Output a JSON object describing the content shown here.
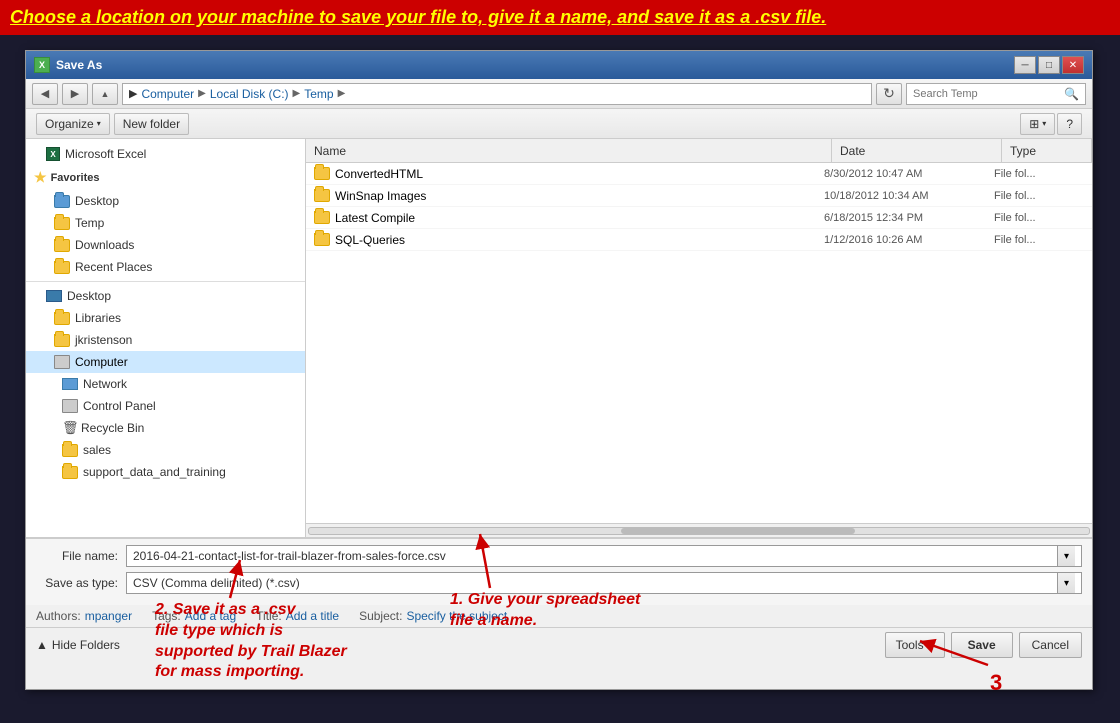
{
  "topBar": {
    "text": "Choose a location on your machine to save your file to, give it a name, and save it as a .csv file."
  },
  "dialog": {
    "title": "Save As",
    "titleIcon": "X",
    "breadcrumbs": [
      {
        "label": "Computer"
      },
      {
        "label": "Local Disk (C:)"
      },
      {
        "label": "Temp"
      }
    ],
    "searchPlaceholder": "Search Temp",
    "toolbar": {
      "organizeLabel": "Organize",
      "newFolderLabel": "New folder"
    },
    "sidebar": {
      "sections": [
        {
          "type": "excel",
          "label": "Microsoft Excel",
          "indent": 0
        },
        {
          "type": "header",
          "label": "Favorites",
          "indent": 0
        },
        {
          "type": "folder-blue",
          "label": "Desktop",
          "indent": 1
        },
        {
          "type": "folder",
          "label": "Temp",
          "indent": 1
        },
        {
          "type": "folder",
          "label": "Downloads",
          "indent": 1
        },
        {
          "type": "folder",
          "label": "Recent Places",
          "indent": 1
        },
        {
          "type": "divider"
        },
        {
          "type": "computer",
          "label": "Desktop",
          "indent": 0
        },
        {
          "type": "folder",
          "label": "Libraries",
          "indent": 1
        },
        {
          "type": "folder",
          "label": "jkristenson",
          "indent": 1
        },
        {
          "type": "computer-active",
          "label": "Computer",
          "indent": 0,
          "active": true
        },
        {
          "type": "network",
          "label": "Network",
          "indent": 1
        },
        {
          "type": "computer",
          "label": "Control Panel",
          "indent": 1
        },
        {
          "type": "recycle",
          "label": "Recycle Bin",
          "indent": 1
        },
        {
          "type": "folder",
          "label": "sales",
          "indent": 1
        },
        {
          "type": "folder",
          "label": "support_data_and_training",
          "indent": 1
        }
      ]
    },
    "fileList": {
      "columns": [
        {
          "label": "Name",
          "key": "name"
        },
        {
          "label": "Date",
          "key": "date"
        },
        {
          "label": "Type",
          "key": "type"
        }
      ],
      "files": [
        {
          "name": "ConvertedHTML",
          "date": "8/30/2012 10:47 AM",
          "type": "File fol..."
        },
        {
          "name": "WinSnap Images",
          "date": "10/18/2012 10:34 AM",
          "type": "File fol..."
        },
        {
          "name": "Latest Compile",
          "date": "6/18/2015 12:34 PM",
          "type": "File fol..."
        },
        {
          "name": "SQL-Queries",
          "date": "1/12/2016 10:26 AM",
          "type": "File fol..."
        }
      ]
    },
    "form": {
      "fileNameLabel": "File name:",
      "fileNameValue": "2016-04-21-contact-list-for-trail-blazer-from-sales-force.csv",
      "saveAsTypeLabel": "Save as type:",
      "saveAsTypeValue": "CSV (Comma delimited) (*.csv)",
      "authorsLabel": "Authors:",
      "authorsValue": "mpanger",
      "tagsLabel": "Tags:",
      "tagsValue": "Add a tag",
      "titleLabel": "Title:",
      "titleValue": "Add a title",
      "subjectLabel": "Subject:",
      "subjectValue": "Specify the subject"
    },
    "buttons": {
      "hideFolders": "Hide Folders",
      "tools": "Tools",
      "save": "Save",
      "cancel": "Cancel"
    }
  },
  "annotations": {
    "step1": {
      "number": "1.",
      "text": "Give your spreadsheet\nfile a name."
    },
    "step2": {
      "number": "2.",
      "text": "Save it as a .csv\nfile type which is\nsupported by Trail Blazer\nfor mass importing."
    },
    "step3": {
      "number": "3"
    }
  }
}
